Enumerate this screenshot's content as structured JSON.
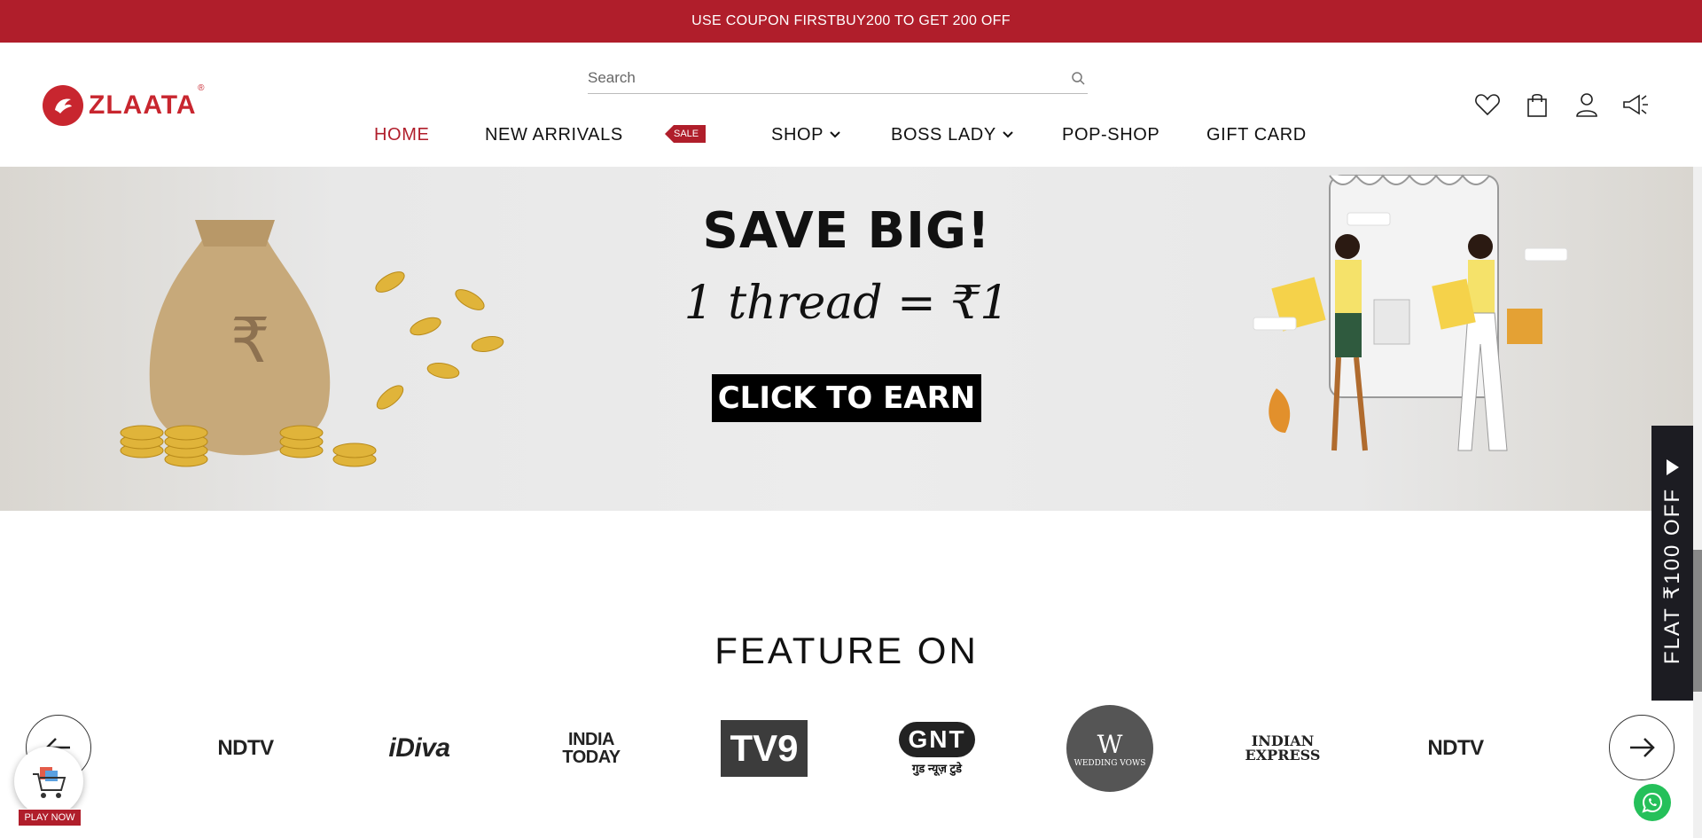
{
  "announcement": {
    "text": "USE COUPON FIRSTBUY200 TO GET 200 OFF"
  },
  "header": {
    "logo_text": "ZLAATA",
    "logo_reg": "®",
    "search": {
      "placeholder": "Search"
    }
  },
  "nav": {
    "home": "HOME",
    "new_arrivals": "NEW ARRIVALS",
    "sale": "SALE",
    "shop": "SHOP",
    "boss_lady": "BOSS LADY",
    "pop_shop": "POP-SHOP",
    "gift_card": "GIFT CARD"
  },
  "header_icons": [
    "heart-icon",
    "shopping-bag-icon",
    "user-icon",
    "megaphone-icon"
  ],
  "banner": {
    "headline": "SAVE BIG!",
    "subline": "1 thread = ₹1",
    "cta": "CLICK TO EARN"
  },
  "feature": {
    "title": "FEATURE ON",
    "brands": [
      "NDTV",
      "iDiva",
      "INDIA TODAY",
      "TV9",
      "GNT",
      "WEDDING VOWS",
      "INDIAN EXPRESS",
      "NDTV"
    ],
    "gnt_sub": "गुड न्यूज़ टुडे"
  },
  "side_offer": {
    "text": "FLAT ₹100 OFF"
  },
  "game_widget": {
    "label": "PLAY NOW"
  },
  "colors": {
    "brand_red": "#b01e2b",
    "dark": "#1c1c22",
    "whatsapp": "#25c05a"
  }
}
